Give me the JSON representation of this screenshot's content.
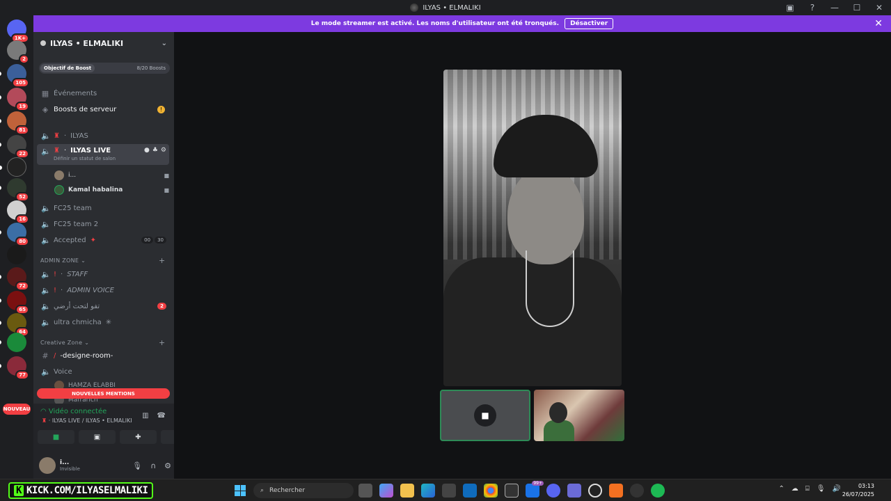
{
  "window": {
    "title": "ILYAS • ELMALIKI"
  },
  "banner": {
    "text": "Le mode streamer est activé. Les noms d'utilisateur ont été tronqués.",
    "button": "Désactiver"
  },
  "rail": {
    "badges": [
      "1K+",
      "2",
      "105",
      "19",
      "81",
      "22",
      "52",
      "16",
      "80",
      "72",
      "65",
      "64",
      "77"
    ],
    "nouveau": "NOUVEAU"
  },
  "guild": {
    "name": "ILYAS • ELMALIKI",
    "boost_goal_label": "Objectif de Boost",
    "boost_goal_value": "8/20 Boosts"
  },
  "channels": {
    "events": "Événements",
    "boosts": "Boosts de serveur",
    "ilyas": "ILYAS",
    "ilyas_live": "ILYAS LIVE",
    "ilyas_live_status": "Définir un statut de salon",
    "user1": "i...",
    "user2": "Kamal habalina",
    "fc25": "FC25 team",
    "fc25_2": "FC25 team 2",
    "accepted": "Accepted",
    "accepted_count_a": "00",
    "accepted_count_b": "30",
    "cat_admin": "ADMIN ZONE",
    "staff": "STAFF",
    "admin_voice": "ADMIN VOICE",
    "arabic": "تفو لتحت أرضي",
    "arabic_badge": "2",
    "ultra": "ultra chmicha",
    "cat_creative": "Creative Zone",
    "designe": "-designe-room-",
    "voice": "Voice",
    "hamza": "HAMZA ELABBI",
    "mafrarich": "Mafrarich",
    "mentions": "NOUVELLES MENTIONS"
  },
  "voice_panel": {
    "status": "Vidéo connectée",
    "channel": "ILYAS LIVE / ILYAS • ELMALIKI"
  },
  "me": {
    "name": "i...",
    "status": "Invisible"
  },
  "taskbar": {
    "kick": "KICK.COM/ILYASELMALIKI",
    "kick_k": "K",
    "search": "Rechercher",
    "badge": "99+",
    "time": "03:13",
    "date": "26/07/2025"
  }
}
